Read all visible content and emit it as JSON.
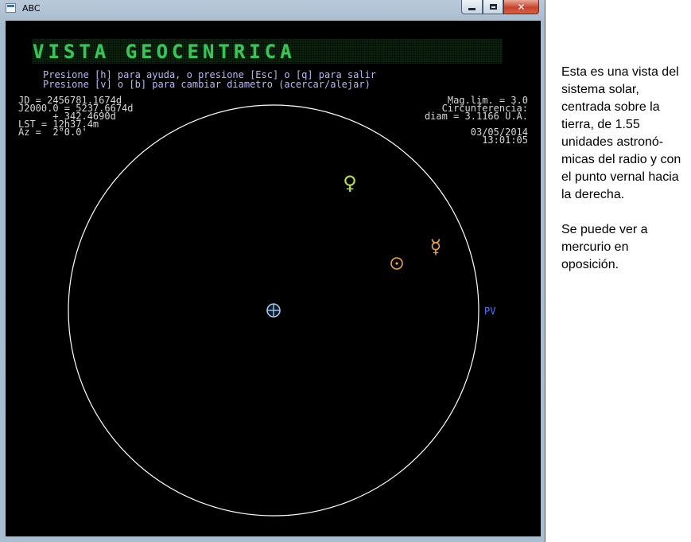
{
  "window": {
    "title": "ABC",
    "icon": "app-window-icon",
    "controls": {
      "minimize": "minimize-icon",
      "maximize": "maximize-icon",
      "close": "close-icon"
    },
    "close_glyph": "✕"
  },
  "app": {
    "banner_title": "VISTA GEOCENTRICA",
    "help_lines": [
      "Presione [h] para ayuda, o presione [Esc] o [q] para salir",
      "Presione [v] o [b] para cambiar diametro (acercar/alejar)"
    ],
    "info_left": [
      "JD = 2456781.1674d",
      "J2000.0 = 5237.6674d",
      "      + 342.4690d",
      "LST = 12h37.4m",
      "Az =  2°0.0'"
    ],
    "info_right": [
      "Mag.lim. = 3.0",
      "Circunferencia:",
      "diam = 3.1166 U.A.",
      "03/05/2014",
      "13:01:05"
    ],
    "vernal_point_label": "PV",
    "bodies": [
      {
        "name": "venus",
        "symbol": "♀",
        "color": "#b6e04a"
      },
      {
        "name": "sun",
        "symbol": "☉",
        "color": "#f0a838"
      },
      {
        "name": "mercury",
        "symbol": "☿",
        "color": "#e8a43c"
      },
      {
        "name": "earth",
        "symbol": "♁",
        "color": "#a7c7ea"
      }
    ],
    "colors": {
      "background": "#000000",
      "help_text": "#b8b8ff",
      "info_text": "#d8d8d8",
      "banner_text": "#39c45a",
      "circle": "#ffffff",
      "vernal_point": "#4a7cff"
    }
  },
  "side_text": {
    "paragraph1": "Esta es una vista del sistema solar, centrada sobre la tierra, de 1.55 unidades astronó-micas del radio y con el punto vernal hacia la derecha.",
    "paragraph2": "Se puede ver a mercurio en oposición."
  }
}
